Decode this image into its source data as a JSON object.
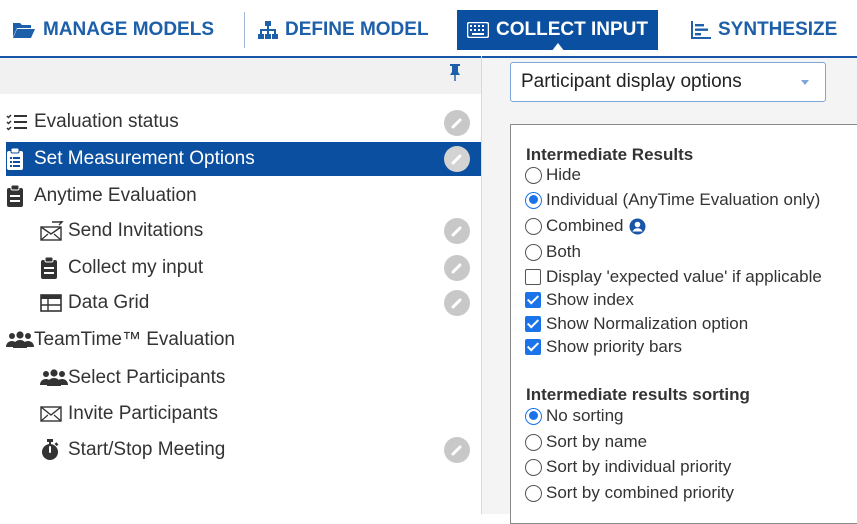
{
  "tabs": [
    {
      "label": "MANAGE MODELS",
      "icon": "folder-open-icon",
      "active": false
    },
    {
      "label": "DEFINE MODEL",
      "icon": "hierarchy-icon",
      "active": false
    },
    {
      "label": "COLLECT INPUT",
      "icon": "keyboard-icon",
      "active": true
    },
    {
      "label": "SYNTHESIZE",
      "icon": "bar-list-icon",
      "active": false
    }
  ],
  "colors": {
    "accent": "#0b4fa0",
    "tab_text": "#1d5fa8",
    "check_blue": "#1a73e8"
  },
  "sidebar": {
    "items": [
      {
        "label": "Evaluation status",
        "icon": "checklist-icon"
      },
      {
        "label": "Set Measurement Options",
        "icon": "clipboard-list-icon",
        "selected": true
      },
      {
        "label": "Anytime Evaluation",
        "icon": "clipboard-icon"
      },
      {
        "label": "Send Invitations",
        "icon": "envelope-send-icon"
      },
      {
        "label": "Collect my input",
        "icon": "clipboard-icon"
      },
      {
        "label": "Data Grid",
        "icon": "table-icon"
      },
      {
        "label": "TeamTime™ Evaluation",
        "icon": "users-icon"
      },
      {
        "label": "Select Participants",
        "icon": "users-icon"
      },
      {
        "label": "Invite Participants",
        "icon": "envelope-icon"
      },
      {
        "label": "Start/Stop Meeting",
        "icon": "stopwatch-icon"
      }
    ]
  },
  "main": {
    "dropdown": {
      "selected": "Participant display options"
    },
    "intermediate_results": {
      "title": "Intermediate Results",
      "options": [
        "Hide",
        "Individual (AnyTime Evaluation only)",
        "Combined",
        "Both"
      ],
      "selected_index": 1,
      "checkboxes": [
        {
          "label": "Display 'expected value' if applicable",
          "checked": false
        },
        {
          "label": "Show index",
          "checked": true
        },
        {
          "label": "Show Normalization option",
          "checked": true
        },
        {
          "label": "Show priority bars",
          "checked": true
        }
      ]
    },
    "sorting": {
      "title": "Intermediate results sorting",
      "options": [
        "No sorting",
        "Sort by name",
        "Sort by individual priority",
        "Sort by combined priority"
      ],
      "selected_index": 0
    }
  }
}
